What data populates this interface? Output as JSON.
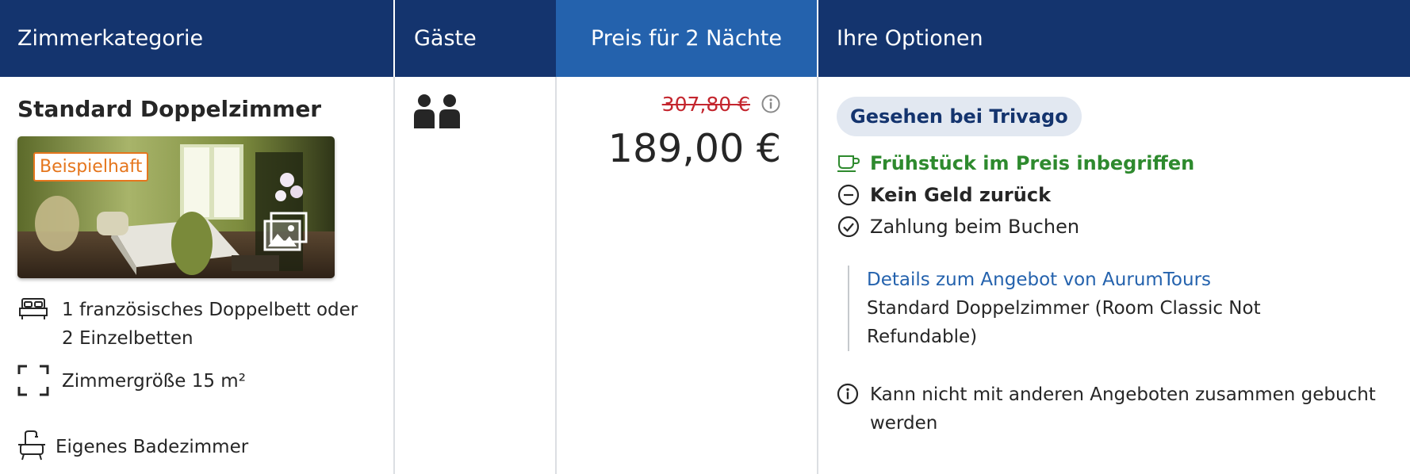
{
  "header": {
    "col_room": "Zimmerkategorie",
    "col_guests": "Gäste",
    "col_price": "Preis für 2 Nächte",
    "col_options": "Ihre Optionen"
  },
  "room": {
    "title": "Standard Doppelzimmer",
    "photo_badge": "Beispielhaft",
    "features": [
      {
        "icon": "bed-icon",
        "line1": "1 französisches Doppelbett oder",
        "line2": "2 Einzelbetten"
      },
      {
        "icon": "room-size-icon",
        "text": "Zimmergröße 15 m²"
      },
      {
        "icon": "bathtub-icon",
        "text": "Eigenes Badezimmer"
      }
    ]
  },
  "guests": {
    "count": 2,
    "icon": "two-persons-icon"
  },
  "price": {
    "old": "307,80 €",
    "current": "189,00 €",
    "old_color": "#c4262e"
  },
  "options": {
    "badge": "Gesehen bei Trivago",
    "breakfast": "Frühstück im Preis inbegriffen",
    "refund": "Kein Geld zurück",
    "payment": "Zahlung beim Buchen",
    "detail_link": "Details zum Angebot von AurumTours",
    "detail_line1": "Standard Doppelzimmer (Room Classic Not",
    "detail_line2": "Refundable)",
    "note_line1": "Kann nicht mit anderen Angeboten zusammen gebucht",
    "note_line2": "werden"
  },
  "colors": {
    "header_bg": "#14346e",
    "price_header_bg": "#2462ad",
    "breakfast_green": "#2e8a2e",
    "link_blue": "#2462ad",
    "badge_orange": "#e5761d"
  }
}
